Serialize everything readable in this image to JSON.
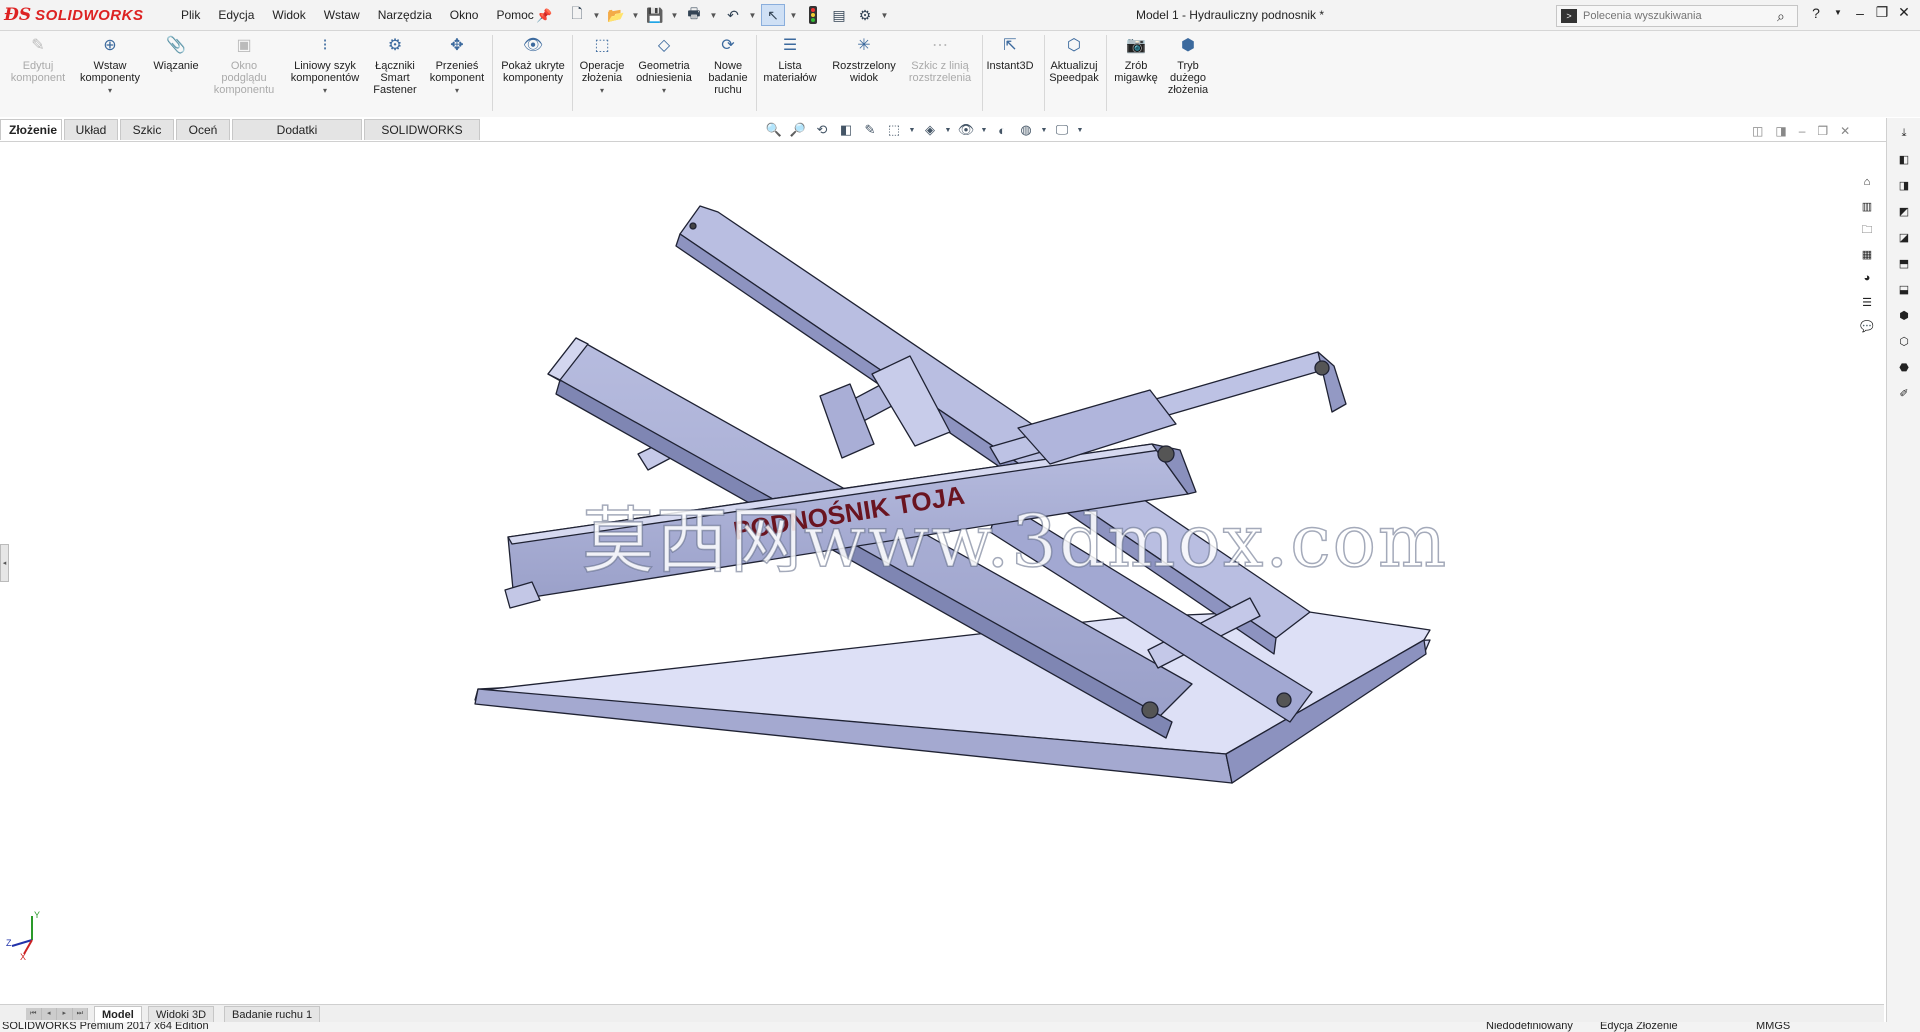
{
  "app": {
    "brand": "SOLIDWORKS",
    "window_title": "Model 1 - Hydrauliczny podnosnik *"
  },
  "menu": [
    "Plik",
    "Edycja",
    "Widok",
    "Wstaw",
    "Narzędzia",
    "Okno",
    "Pomoc"
  ],
  "search": {
    "placeholder": "Polecenia wyszukiwania"
  },
  "ribbon": [
    {
      "id": "edit-component",
      "label": "Edytuj komponent",
      "icon": "edit-component-icon",
      "disabled": true
    },
    {
      "id": "insert-components",
      "label": "Wstaw komponenty",
      "icon": "insert-components-icon",
      "disabled": false,
      "dropdown": true
    },
    {
      "id": "mate",
      "label": "Wiązanie",
      "icon": "mate-icon",
      "disabled": false
    },
    {
      "id": "component-preview",
      "label": "Okno podglądu komponentu",
      "icon": "preview-window-icon",
      "disabled": true
    },
    {
      "id": "linear-pattern",
      "label": "Liniowy szyk komponentów",
      "icon": "linear-pattern-icon",
      "disabled": false,
      "dropdown": true
    },
    {
      "id": "smart-fasteners",
      "label": "Łączniki Smart Fastener",
      "icon": "smart-fastener-icon",
      "disabled": false
    },
    {
      "id": "move-component",
      "label": "Przenieś komponent",
      "icon": "move-component-icon",
      "disabled": false,
      "dropdown": true
    },
    {
      "id": "show-hidden",
      "label": "Pokaż ukryte komponenty",
      "icon": "show-hidden-icon",
      "disabled": false
    },
    {
      "id": "assembly-features",
      "label": "Operacje złożenia",
      "icon": "assembly-features-icon",
      "disabled": false,
      "dropdown": true
    },
    {
      "id": "reference-geometry",
      "label": "Geometria odniesienia",
      "icon": "reference-geometry-icon",
      "disabled": false,
      "dropdown": true
    },
    {
      "id": "new-motion-study",
      "label": "Nowe badanie ruchu",
      "icon": "motion-study-icon",
      "disabled": false
    },
    {
      "id": "bom",
      "label": "Lista materiałów",
      "icon": "bom-icon",
      "disabled": false
    },
    {
      "id": "exploded-view",
      "label": "Rozstrzelony widok",
      "icon": "exploded-view-icon",
      "disabled": false
    },
    {
      "id": "explode-line",
      "label": "Szkic z linią rozstrzelenia",
      "icon": "explode-line-icon",
      "disabled": true
    },
    {
      "id": "instant3d",
      "label": "Instant3D",
      "icon": "instant3d-icon",
      "disabled": false
    },
    {
      "id": "speedpak",
      "label": "Aktualizuj Speedpak",
      "icon": "speedpak-icon",
      "disabled": false
    },
    {
      "id": "snapshot",
      "label": "Zrób migawkę",
      "icon": "camera-icon",
      "disabled": false
    },
    {
      "id": "large-assembly",
      "label": "Tryb dużego złożenia",
      "icon": "large-assembly-icon",
      "disabled": false
    }
  ],
  "tabs": [
    "Złożenie",
    "Układ",
    "Szkic",
    "Oceń",
    "Dodatki SOLIDWORKS",
    "SOLIDWORKS MBD"
  ],
  "active_tab": "Złożenie",
  "model": {
    "part_label": "PODNOŚNIK TOJA",
    "watermark": "莫西网www.3dmox.com"
  },
  "triad": {
    "x": "X",
    "y": "Y",
    "z": "Z"
  },
  "bottom_tabs": [
    "Model",
    "Widoki 3D",
    "Badanie ruchu 1"
  ],
  "active_bottom_tab": "Model",
  "status": {
    "edition": "SOLIDWORKS Premium 2017 x64 Edition",
    "definition": "Niedodefiniowany",
    "mode": "Edycja Złożenie",
    "units": "MMGS"
  },
  "colors": {
    "part_fill": "#aab0d4",
    "part_dark": "#7d84b0",
    "part_light": "#cfd3ec",
    "edge": "#1f2233",
    "label": "#6a1420",
    "brand_red": "#d22222"
  }
}
